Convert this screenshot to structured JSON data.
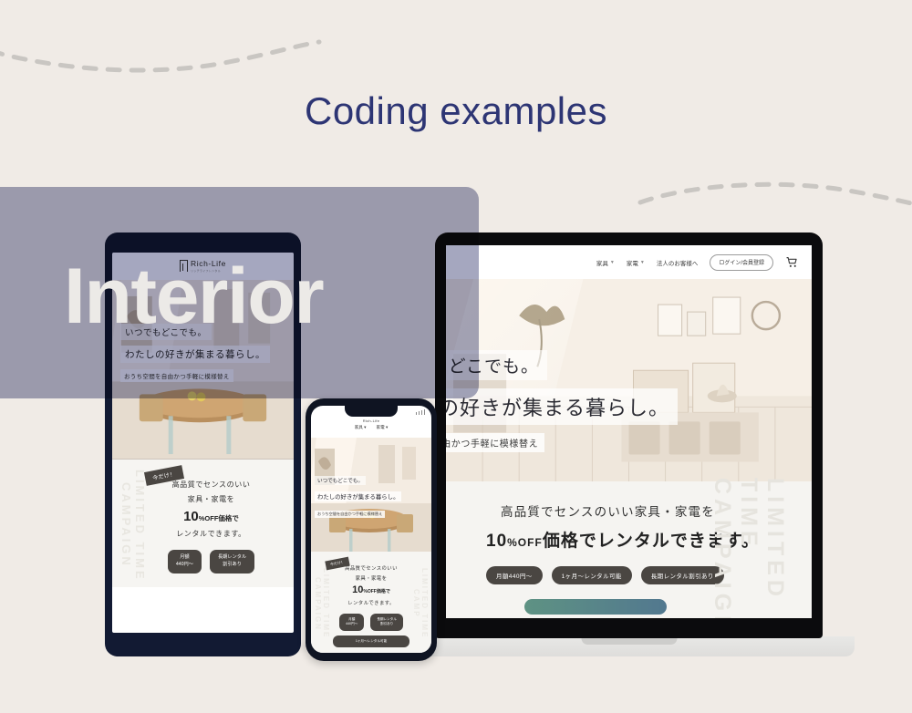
{
  "page": {
    "title": "Coding examples",
    "overlay_word": "Interior",
    "background_color": "#f0ebe6",
    "title_color": "#2d3574",
    "overlay_rect_color": "#a2a4bd",
    "overlay_word_color": "#eceae7"
  },
  "laptop": {
    "device": "laptop",
    "nav": [
      {
        "label": "家具",
        "has_caret": true
      },
      {
        "label": "家電",
        "has_caret": true
      },
      {
        "label": "法人のお客様へ",
        "has_caret": false
      }
    ],
    "login_button": "ログイン/会員登録",
    "cart_icon": "cart-icon",
    "hero": {
      "line1": "いつでもどこでも。",
      "line2": "わたしの好きが集まる暮らし。",
      "line3": "おうち空間を自由かつ手軽に模様替え"
    },
    "campaign": {
      "watermark": "LIMITED TIME CAMPAIGN",
      "line1": "高品質でセンスのいい家具・家電を",
      "amount": "10",
      "percent_off": "%OFF",
      "line2_rest": "価格でレンタルできます。",
      "pills": [
        "月額440円〜",
        "1ヶ月〜レンタル可能",
        "長期レンタル割引あり"
      ],
      "cta_gradient_from": "#5e9283",
      "cta_gradient_to": "#52788f"
    }
  },
  "tablet": {
    "device": "tablet",
    "logo": {
      "name": "Rich-Life",
      "sub": "リッチライフレンタル"
    },
    "hero": {
      "line1": "いつでもどこでも。",
      "line2": "わたしの好きが集まる暮らし。",
      "line3": "おうち空間を自由かつ手軽に模様替え"
    },
    "campaign": {
      "watermark": "LIMITED TIME CAMPAIGN",
      "badge": "今だけ！",
      "line1": "高品質でセンスのいい",
      "line2": "家具・家電を",
      "amount": "10",
      "percent_off": "%OFF",
      "line3_rest": "価格で",
      "line4": "レンタルできます。",
      "pills": [
        "月額\n440円〜",
        "長期レンタル\n割引あり"
      ],
      "pill1_top": "月額",
      "pill1_bottom": "440円〜",
      "pill2_top": "長期レンタル",
      "pill2_bottom": "割引あり"
    }
  },
  "phone": {
    "device": "phone",
    "logo": "Rich-Life",
    "nav": [
      {
        "label": "家具",
        "has_caret": true
      },
      {
        "label": "家電",
        "has_caret": true
      }
    ],
    "hero": {
      "line1": "いつでもどこでも。",
      "line2": "わたしの好きが集まる暮らし。",
      "line3": "おうち空間を自由かつ手軽に模様替え"
    },
    "campaign": {
      "watermark_left": "LIMITED TIME CAMPAIGN",
      "watermark_right": "LIMITED TIME CAMP",
      "badge": "今だけ！",
      "line1": "高品質でセンスのいい",
      "line2": "家具・家電を",
      "amount": "10",
      "percent_off": "%OFF",
      "line3_rest": "価格で",
      "line4": "レンタルできます。",
      "pill1_top": "月額",
      "pill1_bottom": "440円〜",
      "pill2_top": "長期レンタル",
      "pill2_bottom": "割引あり",
      "pill3": "1ヶ月〜レンタル可能"
    }
  }
}
